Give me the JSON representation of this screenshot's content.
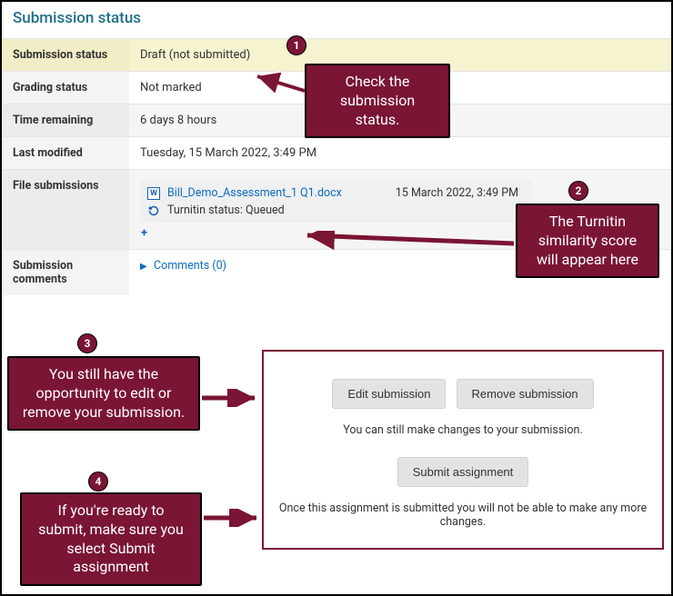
{
  "page_title": "Submission status",
  "rows": {
    "submission_status": {
      "label": "Submission status",
      "value": "Draft (not submitted)"
    },
    "grading_status": {
      "label": "Grading status",
      "value": "Not marked"
    },
    "time_remaining": {
      "label": "Time remaining",
      "value": "6 days 8 hours"
    },
    "last_modified": {
      "label": "Last modified",
      "value": "Tuesday, 15 March 2022, 3:49 PM"
    },
    "file_submissions": {
      "label": "File submissions"
    },
    "submission_comments": {
      "label": "Submission comments",
      "link": "Comments (0)"
    }
  },
  "file": {
    "name": "Bill_Demo_Assessment_1 Q1.docx",
    "date": "15 March 2022, 3:49 PM",
    "turnitin": "Turnitin status: Queued"
  },
  "actions": {
    "edit": "Edit submission",
    "remove": "Remove submission",
    "note1": "You can still make changes to your submission.",
    "submit": "Submit assignment",
    "note2": "Once this assignment is submitted you will not be able to make any more changes."
  },
  "callouts": {
    "c1": "Check the submission status.",
    "c2": "The Turnitin similarity score will appear here",
    "c3": "You still have the opportunity to edit or remove your submission.",
    "c4": "If you're ready to submit, make sure you select Submit assignment"
  },
  "badges": {
    "b1": "1",
    "b2": "2",
    "b3": "3",
    "b4": "4"
  }
}
